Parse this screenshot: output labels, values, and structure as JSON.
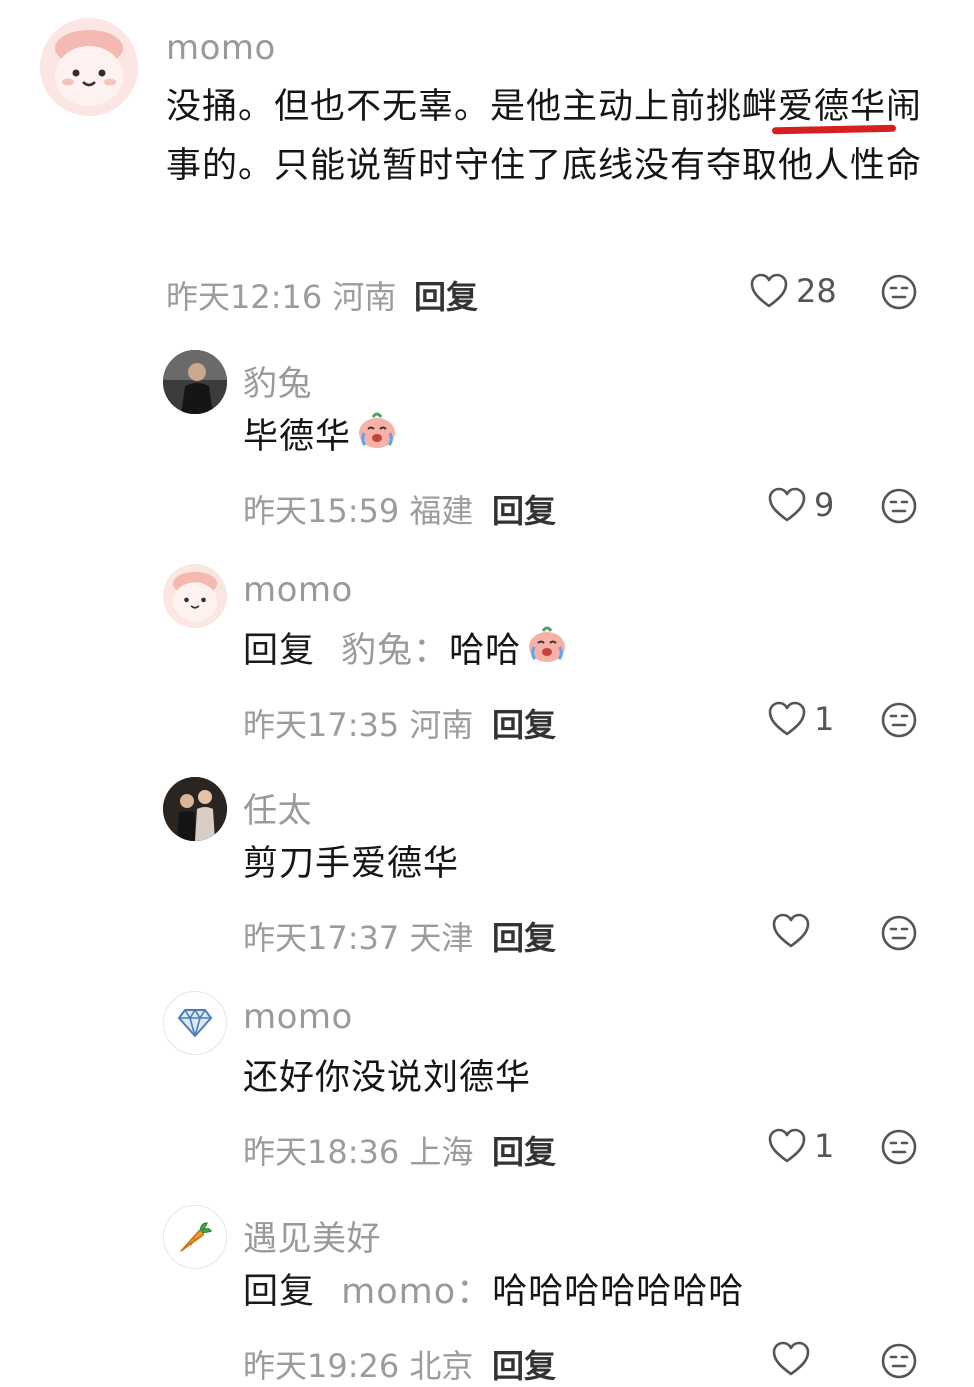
{
  "comments": [
    {
      "name": "momo",
      "text_a": "没捅。但也不无辜。是他主动上前挑衅",
      "text_highlight": "爱德华",
      "text_b": "闹事的。只能说暂时守住了底线没有夺取他人性命",
      "meta": "昨天12:16 河南",
      "reply": "回复",
      "likes": "28"
    },
    {
      "name": "豹兔",
      "text": "毕德华",
      "meta": "昨天15:59 福建",
      "reply": "回复",
      "likes": "9"
    },
    {
      "name": "momo",
      "reply_prefix": "回复",
      "reply_to": "豹兔：",
      "text": "哈哈",
      "meta": "昨天17:35 河南",
      "reply": "回复",
      "likes": "1"
    },
    {
      "name": "任太",
      "text": "剪刀手爱德华",
      "meta": "昨天17:37 天津",
      "reply": "回复",
      "likes": ""
    },
    {
      "name": "momo",
      "text": "还好你没说刘德华",
      "meta": "昨天18:36 上海",
      "reply": "回复",
      "likes": "1"
    },
    {
      "name": "遇见美好",
      "reply_prefix": "回复",
      "reply_to": "momo：",
      "text": "哈哈哈哈哈哈哈",
      "meta": "昨天19:26 北京",
      "reply": "回复",
      "likes": ""
    }
  ],
  "icons": {
    "like": "heart-outline-icon",
    "dislike": "neutral-face-icon",
    "avatar_diamond": "diamond-icon",
    "avatar_carrot": "carrot-icon"
  },
  "colors": {
    "highlight_underline": "#d81e1e",
    "meta_gray": "#9c9c9c"
  }
}
